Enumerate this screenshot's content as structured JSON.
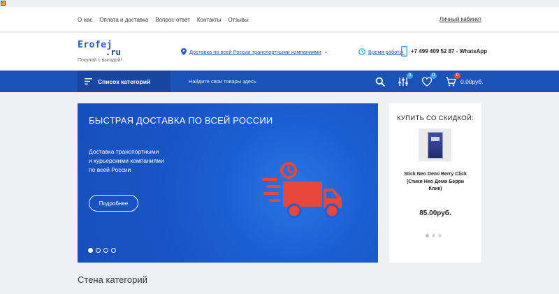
{
  "topnav": {
    "items": [
      "О нас",
      "Оплата и доставка",
      "Вопрос-ответ",
      "Контакты",
      "Отзывы"
    ],
    "cabinet": "Личный кабинет"
  },
  "header": {
    "logo_main": "Erofej",
    "logo_tld": ".ru",
    "logo_tagline": "Покупай с выгодой!",
    "delivery": "Доставка по всей России транспортными компаниями",
    "hours": "Время работы",
    "phone": "+7 499 409 52 87 - WhatsApp"
  },
  "navbar": {
    "catalog_label": "Список категорий",
    "search_placeholder": "Найдите свои товары здесь",
    "compare_count": "0",
    "wishlist_count": "0",
    "cart_count": "0",
    "cart_total": "0.00руб."
  },
  "hero": {
    "title": "БЫСТРАЯ ДОСТАВКА ПО ВСЕЙ РОССИИ",
    "subtitle": "Доставка транспортными\nи курьерскими компаниями\nпо всей России",
    "button": "Подробнее",
    "slides": 4,
    "active_slide": 1
  },
  "sale": {
    "title": "КУПИТЬ СО СКИДКОЙ:",
    "product_name": "Stick Neo Demi Berry Click (Стики Нео Деми Берри Клик)",
    "product_price": "85.00руб.",
    "pages": 3,
    "active_page": 1
  },
  "section": {
    "title": "Стена категорий"
  },
  "colors": {
    "brand_blue": "#1a52b5",
    "hero_blue": "#1c5fd4",
    "truck_red": "#e8473a"
  }
}
